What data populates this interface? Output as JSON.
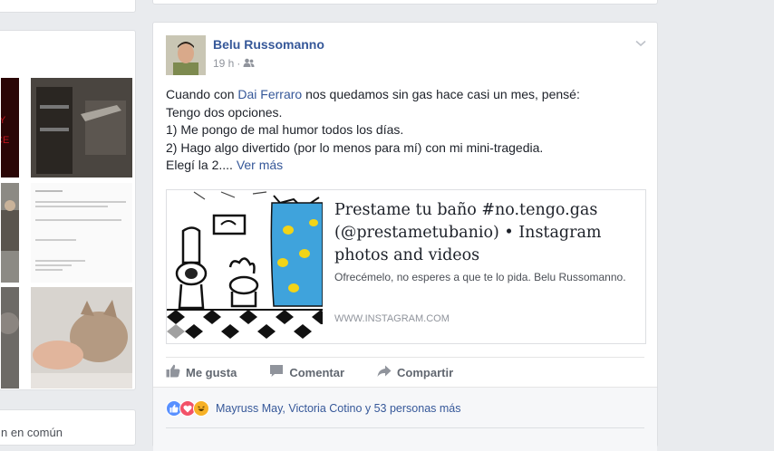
{
  "left_column": {
    "bottom_text": "n en común"
  },
  "post": {
    "author": "Belu Russomanno",
    "time": "19 h",
    "separator": "·",
    "text": {
      "line1_prefix": "Cuando con ",
      "line1_link": "Dai Ferraro",
      "line1_suffix": " nos quedamos sin gas hace casi un mes, pensé:",
      "line2": "Tengo dos opciones.",
      "line3": "1) Me pongo de mal humor todos los días.",
      "line4": "2) Hago algo divertido (por lo menos para mí) con mi mini-tragedia.",
      "line5": "Elegí la 2.... ",
      "see_more": "Ver más"
    },
    "shared_link": {
      "title": "Prestame tu baño #no.tengo.gas (@prestametubanio) • Instagram photos and videos",
      "description": "Ofrecémelo, no esperes a que te lo pida. Belu Russomanno.",
      "domain": "WWW.INSTAGRAM.COM"
    },
    "actions": {
      "like": "Me gusta",
      "comment": "Comentar",
      "share": "Compartir"
    },
    "reactions_text": "Mayruss May, Victoria Cotino y 53 personas más"
  },
  "colors": {
    "link": "#365899",
    "like_blue": "#5890ff",
    "love_red": "#f25268",
    "haha_yellow": "#f7b125",
    "background": "#e9ebee"
  }
}
